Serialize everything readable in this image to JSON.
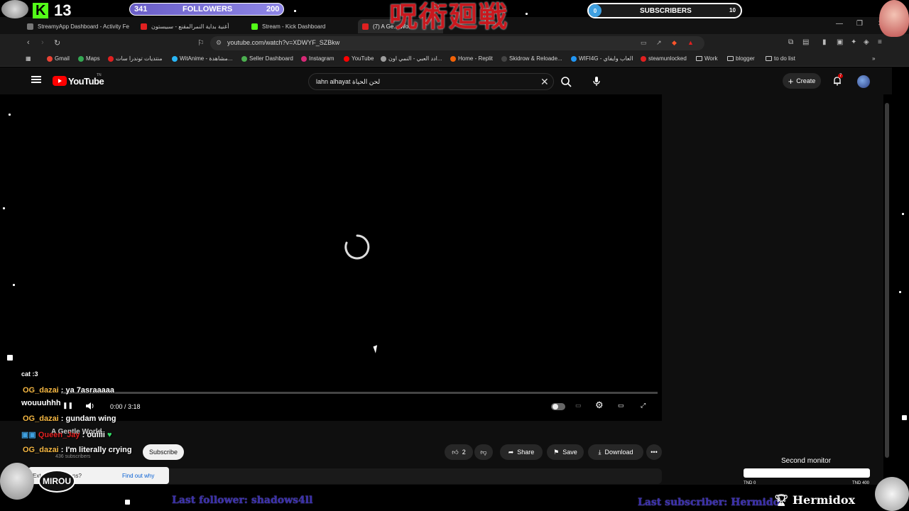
{
  "browser": {
    "tabs": [
      {
        "label": "StreamyApp Dashboard - Activity Fe",
        "color": "#777777"
      },
      {
        "label": "أغنية بداية النمرالمقنع - سبيستون",
        "color": "#e02020"
      },
      {
        "label": "Stream - Kick Dashboard",
        "color": "#53fc18"
      },
      {
        "label": "(7) A Ge... Wo...",
        "color": "#e02020"
      }
    ],
    "url": "youtube.com/watch?v=XDWYF_SZBkw"
  },
  "bookmarks": [
    {
      "label": "Gmail",
      "color": "#ea4335"
    },
    {
      "label": "Maps",
      "color": "#34a853"
    },
    {
      "label": "منتديات توندرا سات",
      "color": "#e02020"
    },
    {
      "label": "WitAnime - مشاهدة...",
      "color": "#29b6f6"
    },
    {
      "label": "Seller Dashboard",
      "color": "#4caf50"
    },
    {
      "label": "Instagram",
      "color": "#d62976"
    },
    {
      "label": "YouTube",
      "color": "#ff0000"
    },
    {
      "label": "ادد العبي - النمي اون...",
      "color": "#9e9e9e"
    },
    {
      "label": "Home - Replit",
      "color": "#f26207"
    },
    {
      "label": "Skidrow & Reloade...",
      "color": "#444444"
    },
    {
      "label": "WIFI4G - العاب وايفاي",
      "color": "#2196f3"
    },
    {
      "label": "steamunlocked",
      "color": "#e02020"
    },
    {
      "label": "Work",
      "folder": true
    },
    {
      "label": "blogger",
      "folder": true
    },
    {
      "label": "to do list",
      "folder": true
    }
  ],
  "youtube": {
    "logo_text": "YouTube",
    "logo_sup": "TN",
    "search_value": "lahn alhayat لحن الحياة",
    "create_label": "Create",
    "notification_count": "7",
    "time": "0:00 / 3:18",
    "like_count": "2",
    "share_label": "Share",
    "save_label": "Save",
    "download_label": "Download",
    "subscribe_label": "Subscribe",
    "channel_name": "A Gentle World",
    "subscriber_count": "436 subscribers",
    "notice_text": "Ext... interruptions?",
    "notice_link": "Find out why"
  },
  "overlay": {
    "kick_count": "13",
    "followers": {
      "current": "341",
      "label": "FOLLOWERS",
      "goal": "200"
    },
    "subscribers": {
      "current": "0",
      "label": "SUBSCRIBERS",
      "goal": "10"
    },
    "jjk_title": "呪術廻戦",
    "chat": [
      {
        "user": "cat :3",
        "msg": ""
      },
      {
        "user": "OG_dazai",
        "msg": " : ya 7asraaaaa"
      },
      {
        "user": "",
        "msg": "wouuuhhh"
      },
      {
        "user": "OG_dazai",
        "msg": " : gundam wing"
      },
      {
        "user": "Queen_Jay",
        "msg": " : ouiiii"
      },
      {
        "user": "OG_dazai",
        "msg": " : I'm literally crying"
      }
    ],
    "second_monitor": {
      "title": "Second monitor",
      "left": "TND 0",
      "right": "TND 400",
      "progress": 0
    },
    "last_follower": "Last follower: shadows4ll",
    "last_subscriber": "Last subscriber: Hermido",
    "streamer_name": "Hermidox",
    "mirou": "MIROU"
  }
}
